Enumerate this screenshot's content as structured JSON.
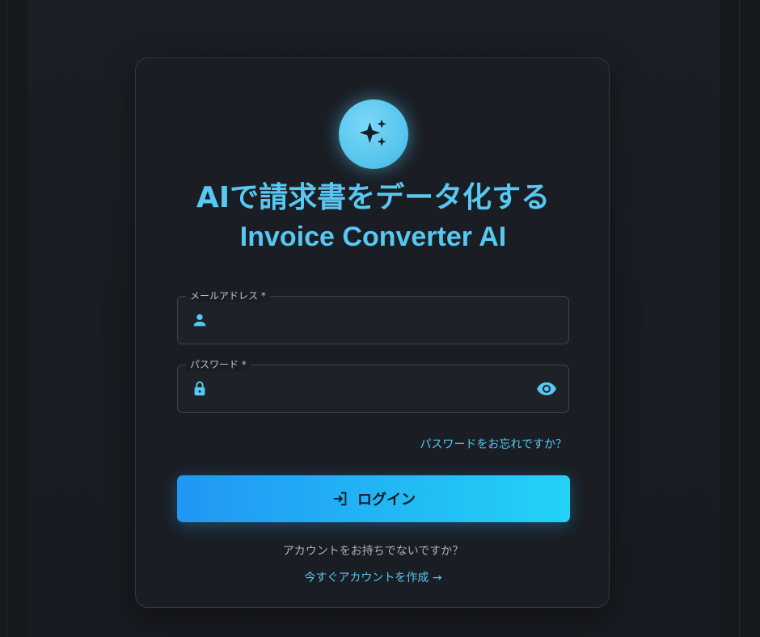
{
  "app": {
    "title_jp": "AIで請求書をデータ化する",
    "title_en": "Invoice Converter AI",
    "logo_icon": "sparkles-icon"
  },
  "form": {
    "email": {
      "label": "メールアドレス *",
      "value": "",
      "placeholder": "",
      "icon": "person-icon"
    },
    "password": {
      "label": "パスワード *",
      "value": "",
      "placeholder": "",
      "icon": "lock-icon",
      "toggle_icon": "eye-icon"
    },
    "forgot_password": "パスワードをお忘れですか？",
    "login_button": "ログイン",
    "login_icon": "login-icon"
  },
  "footer": {
    "no_account": "アカウントをお持ちでないですか？",
    "create_account": "今すぐアカウントを作成 →"
  },
  "colors": {
    "accent": "#56c8f2",
    "button_start": "#2196f3",
    "button_end": "#22d3f6",
    "card_bg": "#1a1d23",
    "page_bg": "#15181d"
  }
}
